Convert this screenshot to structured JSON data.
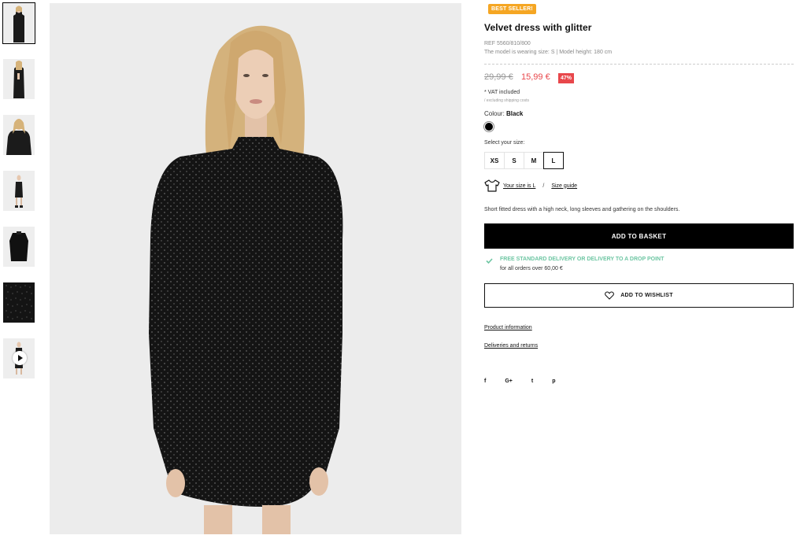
{
  "badge": "BEST SELLER!",
  "product": {
    "title": "Velvet dress with glitter",
    "ref": "REF 5560/810/800",
    "model_info": "The model is wearing size: S | Model height: 180 cm",
    "price_old": "29,99 €",
    "price_new": "15,99 €",
    "discount": "47%",
    "vat": "* VAT included",
    "shipping_note": "/ excluding shipping costs",
    "colour_label": "Colour:",
    "colour_value": "Black",
    "select_size_label": "Select your size:",
    "sizes": [
      "XS",
      "S",
      "M",
      "L"
    ],
    "selected_size": "L",
    "your_size_link": "Your size is L",
    "size_guide_link": "Size guide",
    "description": "Short fitted dress with a high neck, long sleeves and gathering on the shoulders."
  },
  "actions": {
    "add_to_basket": "ADD TO BASKET",
    "add_to_wishlist": "ADD TO WISHLIST"
  },
  "delivery": {
    "title": "FREE STANDARD DELIVERY OR DELIVERY TO A DROP POINT",
    "subtitle": "for all orders over 60,00 €"
  },
  "links": {
    "product_info": "Product information",
    "deliveries": "Deliveries and returns"
  },
  "social": [
    "f",
    "G+",
    "t",
    "p"
  ],
  "icons": {
    "play": "play-icon",
    "tshirt": "tshirt-icon",
    "check": "check-icon",
    "heart": "heart-icon"
  },
  "colors": {
    "accent_red": "#e8474b",
    "badge_orange": "#f5a623",
    "delivery_green": "#6ec6a3"
  }
}
